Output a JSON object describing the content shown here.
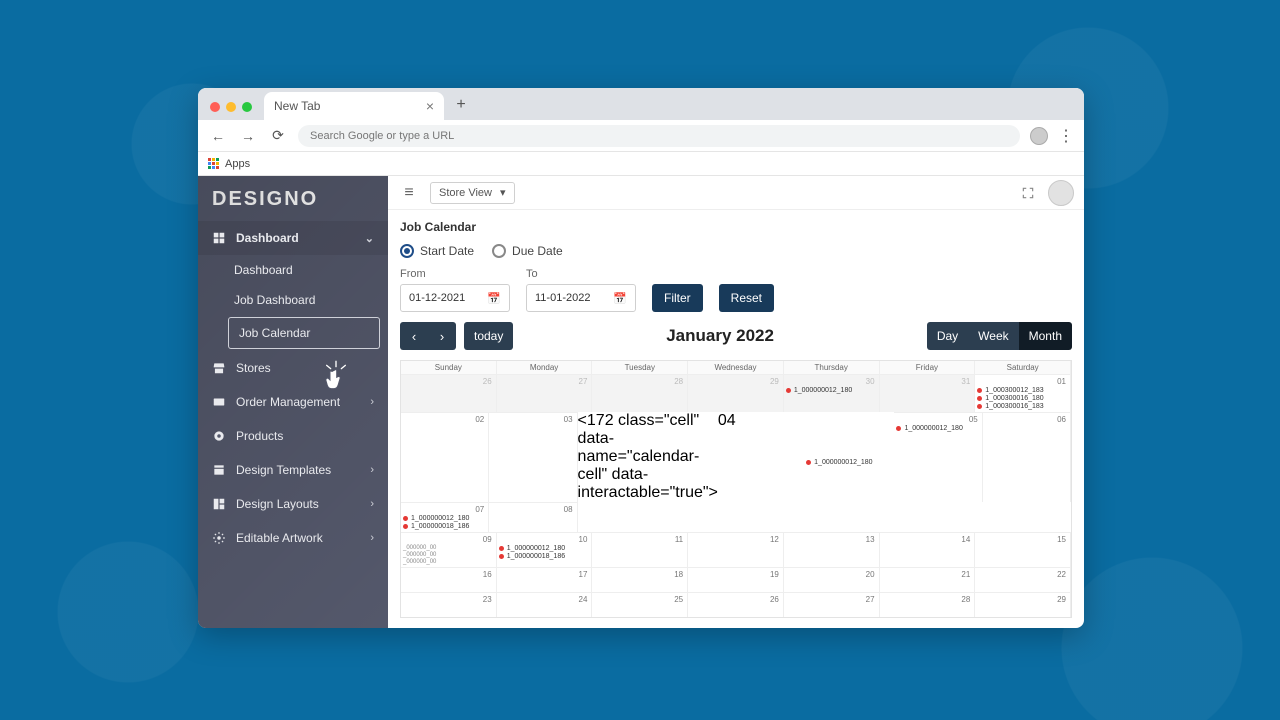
{
  "browser": {
    "tab_title": "New Tab",
    "url_placeholder": "Search Google or type a URL",
    "apps_label": "Apps"
  },
  "brand": "DESIGNO",
  "sidebar": {
    "dashboard": "Dashboard",
    "sub_dashboard": "Dashboard",
    "sub_job_dashboard": "Job Dashboard",
    "sub_job_calendar": "Job Calendar",
    "stores": "Stores",
    "order_management": "Order Management",
    "products": "Products",
    "design_templates": "Design Templates",
    "design_layouts": "Design Layouts",
    "editable_artwork": "Editable Artwork"
  },
  "topbar": {
    "store_view": "Store View"
  },
  "page": {
    "title": "Job Calendar",
    "radio_start": "Start Date",
    "radio_due": "Due Date",
    "from_label": "From",
    "to_label": "To",
    "from_value": "01-12-2021",
    "to_value": "11-01-2022",
    "filter": "Filter",
    "reset": "Reset",
    "today": "today",
    "month_title": "January 2022",
    "view_day": "Day",
    "view_week": "Week",
    "view_month": "Month"
  },
  "daynames": [
    "Sunday",
    "Monday",
    "Tuesday",
    "Wednesday",
    "Thursday",
    "Friday",
    "Saturday"
  ],
  "cells": {
    "r0": [
      "26",
      "27",
      "28",
      "29",
      "30",
      "31",
      "01"
    ],
    "r1": [
      "02",
      "03",
      "04",
      "05",
      "06",
      "07",
      "08"
    ],
    "r2": [
      "09",
      "10",
      "11",
      "12",
      "13",
      "14",
      "15"
    ],
    "r3": [
      "16",
      "17",
      "18",
      "19",
      "20",
      "21",
      "22"
    ],
    "r4": [
      "23",
      "24",
      "25",
      "26",
      "27",
      "28",
      "29"
    ]
  },
  "events": {
    "dec30": "1_000000012_180",
    "jan01a": "1_000300012_183",
    "jan01b": "1_000300016_180",
    "jan01c": "1_000300016_183",
    "jan04": "1_000000012_180",
    "jan05": "1_000000012_180",
    "jan07a": "1_000000012_180",
    "jan07b": "1_000000018_186",
    "jan10a": "1_000000012_180",
    "jan10b": "1_000000018_186",
    "jan09a": "_000000_00",
    "jan09b": "_000000_00",
    "jan09c": "_000000_00"
  }
}
